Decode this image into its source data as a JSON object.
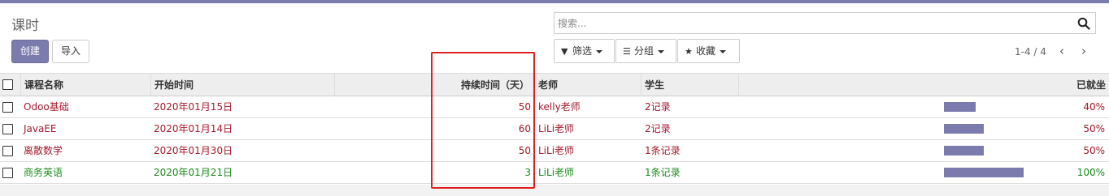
{
  "page": {
    "title": "课时"
  },
  "toolbar": {
    "create_label": "创建",
    "import_label": "导入"
  },
  "search": {
    "placeholder": "搜索..."
  },
  "filters": {
    "filter_label": "筛选",
    "group_label": "分组",
    "favorite_label": "收藏"
  },
  "pager": {
    "text": "1-4 / 4",
    "prev": "‹",
    "next": "›"
  },
  "table": {
    "columns": [
      "课程名称",
      "开始时间",
      "持续时间（天）",
      "老师",
      "学生",
      "已就坐"
    ],
    "rows": [
      {
        "course": "Odoo基础",
        "start": "2020年01月15日",
        "duration": "50",
        "teacher": "kelly老师",
        "students": "2记录",
        "seated": "40%",
        "seated_value": 0.4,
        "color": "red"
      },
      {
        "course": "JavaEE",
        "start": "2020年01月14日",
        "duration": "60",
        "teacher": "LiLi老师",
        "students": "2记录",
        "seated": "50%",
        "seated_value": 0.5,
        "color": "red"
      },
      {
        "course": "离散数学",
        "start": "2020年01月30日",
        "duration": "50",
        "teacher": "LiLi老师",
        "students": "1条记录",
        "seated": "50%",
        "seated_value": 0.5,
        "color": "red"
      },
      {
        "course": "商务英语",
        "start": "2020年01月21日",
        "duration": "3",
        "teacher": "LiLi老师",
        "students": "1条记录",
        "seated": "100%",
        "seated_value": 1.0,
        "color": "green"
      }
    ]
  },
  "colors": {
    "brand": "#7c7bad",
    "row_red": "#a5192c",
    "row_green": "#1a8a1a",
    "highlight": "#e0201f"
  }
}
